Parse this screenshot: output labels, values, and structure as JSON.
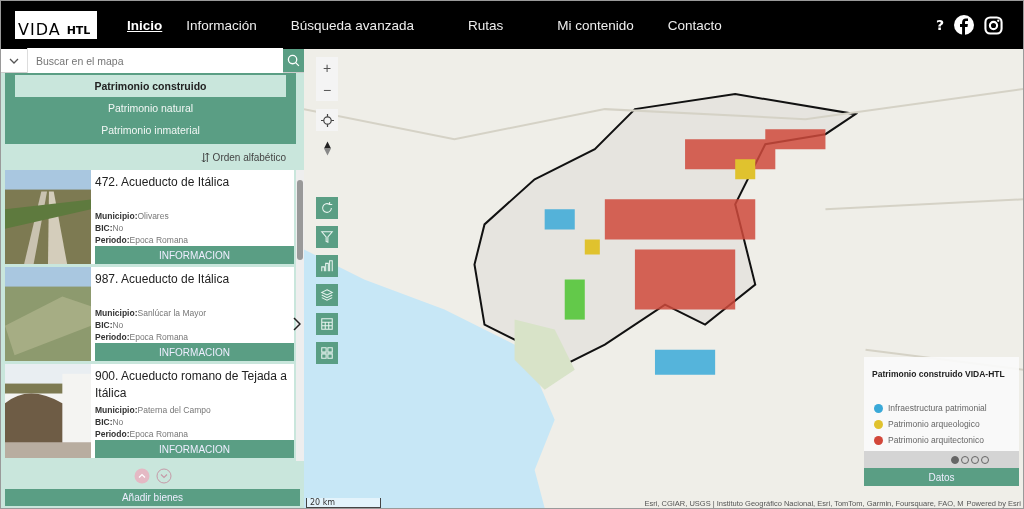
{
  "header": {
    "logo": {
      "word": "VIDA",
      "suffix": "HTL"
    },
    "nav": [
      {
        "label": "Inicio",
        "selected": true
      },
      {
        "label": "Información",
        "selected": false
      },
      {
        "label": "Búsqueda avanzada",
        "selected": false
      },
      {
        "label": "Rutas",
        "selected": false
      },
      {
        "label": "Mi contenido",
        "selected": false
      },
      {
        "label": "Contacto",
        "selected": false
      }
    ],
    "help": "?"
  },
  "sidebar": {
    "search": {
      "placeholder": "Buscar en el mapa"
    },
    "categories": [
      {
        "label": "Patrimonio construido",
        "selected": true
      },
      {
        "label": "Patrimonio natural",
        "selected": false
      },
      {
        "label": "Patrimonio inmaterial",
        "selected": false
      }
    ],
    "sort": "Orden alfabético",
    "items": [
      {
        "title": "472. Acueducto de Itálica",
        "fields": [
          {
            "label": "Municipio:",
            "value": "Olivares"
          },
          {
            "label": "BIC:",
            "value": "No"
          },
          {
            "label": "Periodo:",
            "value": "Epoca Romana"
          }
        ],
        "button": "INFORMACION"
      },
      {
        "title": "987. Acueducto de Itálica",
        "fields": [
          {
            "label": "Municipio:",
            "value": "Sanlúcar la Mayor"
          },
          {
            "label": "BIC:",
            "value": "No"
          },
          {
            "label": "Periodo:",
            "value": "Epoca Romana"
          }
        ],
        "button": "INFORMACION"
      },
      {
        "title": "900. Acueducto romano de Tejada a Itálica",
        "fields": [
          {
            "label": "Municipio:",
            "value": "Paterna del Campo"
          },
          {
            "label": "BIC:",
            "value": "No"
          },
          {
            "label": "Periodo:",
            "value": "Epoca Romana"
          }
        ],
        "button": "INFORMACION"
      }
    ],
    "add_button": "Añadir bienes"
  },
  "map": {
    "zoom_in": "+",
    "zoom_out": "−",
    "scale": "20 km",
    "attribution": "Esri, CGIAR, USGS | Instituto Geográfico Nacional, Esri, TomTom, Garmin, Foursquare, FAO, M",
    "powered": "Powered by Esri",
    "legend": {
      "title": "Patrimonio construido VIDA-HTL",
      "items": [
        {
          "label": "Infraestructura patrimonial",
          "color": "#3aa9d8"
        },
        {
          "label": "Patrimonio arqueologico",
          "color": "#e0c22e"
        },
        {
          "label": "Patrimonio arquitectonico",
          "color": "#d2473a"
        }
      ],
      "pages": [
        {
          "selected": true
        },
        {
          "selected": false
        },
        {
          "selected": false
        },
        {
          "selected": false
        }
      ],
      "button": "Datos"
    }
  }
}
